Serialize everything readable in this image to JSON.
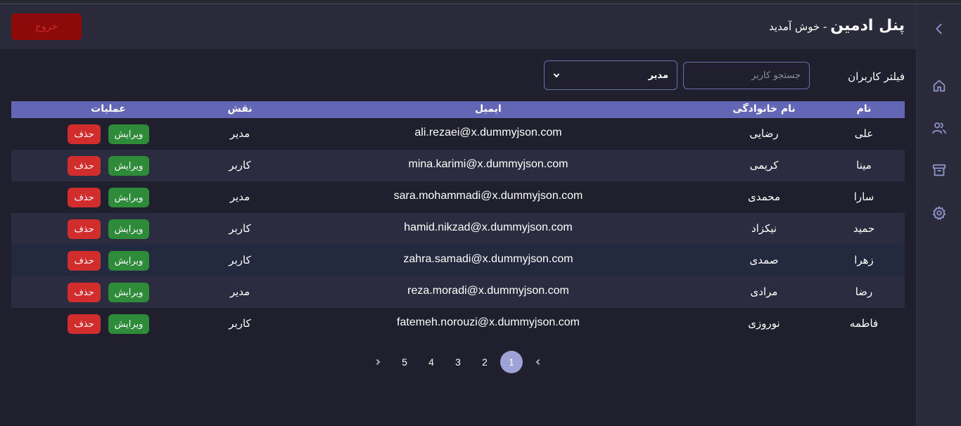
{
  "header": {
    "title_main": "پنل ادمین",
    "title_sub": " - خوش آمدید",
    "logout_label": "خروج"
  },
  "sidebar": {
    "items": [
      {
        "icon": "chevron-left-icon"
      },
      {
        "icon": "home-icon"
      },
      {
        "icon": "users-icon"
      },
      {
        "icon": "archive-icon"
      },
      {
        "icon": "gear-icon"
      }
    ]
  },
  "filters": {
    "label": "فیلتر کاربران",
    "search_placeholder": "جستجو کاربر",
    "role_value": "مدیر"
  },
  "table": {
    "headers": {
      "name": "نام",
      "family": "نام خانوادگی",
      "email": "ایمیل",
      "role": "نقش",
      "actions": "عملیات"
    },
    "edit_label": "ویرایش",
    "delete_label": "حذف",
    "rows": [
      {
        "name": "علی",
        "family": "رضایی",
        "email": "ali.rezaei@x.dummyjson.com",
        "role": "مدیر"
      },
      {
        "name": "مینا",
        "family": "کریمی",
        "email": "mina.karimi@x.dummyjson.com",
        "role": "کاربر"
      },
      {
        "name": "سارا",
        "family": "محمدی",
        "email": "sara.mohammadi@x.dummyjson.com",
        "role": "مدیر"
      },
      {
        "name": "حمید",
        "family": "نیکزاد",
        "email": "hamid.nikzad@x.dummyjson.com",
        "role": "کاربر"
      },
      {
        "name": "زهرا",
        "family": "صمدی",
        "email": "zahra.samadi@x.dummyjson.com",
        "role": "کاربر"
      },
      {
        "name": "رضا",
        "family": "مرادی",
        "email": "reza.moradi@x.dummyjson.com",
        "role": "مدیر"
      },
      {
        "name": "فاطمه",
        "family": "نوروزی",
        "email": "fatemeh.norouzi@x.dummyjson.com",
        "role": "کاربر"
      }
    ]
  },
  "pagination": {
    "pages": [
      "1",
      "2",
      "3",
      "4",
      "5"
    ],
    "active": "1"
  },
  "colors": {
    "accent": "#6266b4",
    "edit": "#2e8b3a",
    "delete": "#d12d2d",
    "logout": "#8c0a0a"
  }
}
